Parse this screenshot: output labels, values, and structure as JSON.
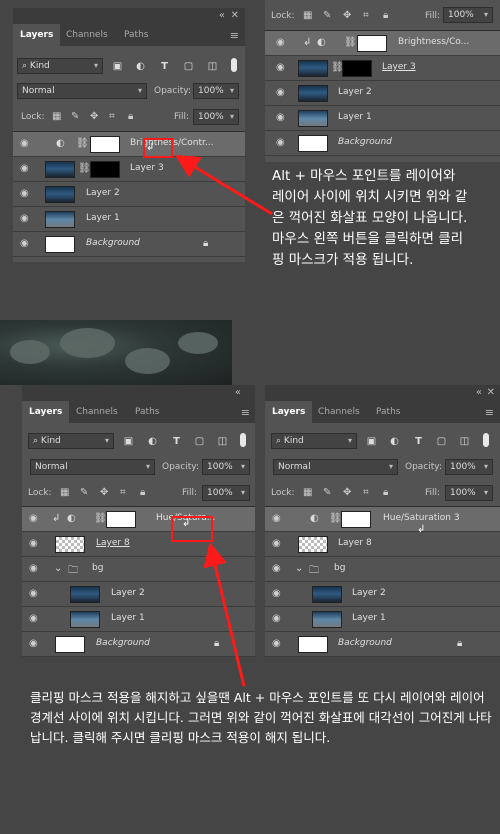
{
  "colors": {
    "accent_red": "#ff1a1a",
    "panel_bg": "#535353",
    "text_white": "#ffffff"
  },
  "panel_a": {
    "tabs": [
      "Layers",
      "Channels",
      "Paths"
    ],
    "filter_kind": "Kind",
    "blend_mode": "Normal",
    "opacity_label": "Opacity:",
    "opacity_value": "100%",
    "lock_label": "Lock:",
    "fill_label": "Fill:",
    "fill_value": "100%",
    "layers": [
      "Brightness/Contr...",
      "Layer 3",
      "Layer 2",
      "Layer 1",
      "Background"
    ]
  },
  "panel_b": {
    "lock_label": "Lock:",
    "fill_label": "Fill:",
    "fill_value": "100%",
    "layers": [
      "Brightness/Co...",
      "Layer 3",
      "Layer 2",
      "Layer 1",
      "Background"
    ]
  },
  "note_top": "Alt + 마우스 포인트를 레이어와 레이어 사이에 위치 시키면 위와 같은 꺽어진 화살표 모양이 나옵니다. 마우스 왼쪽 버튼을 클릭하면 클리핑 마스크가 적용 됩니다.",
  "panel_c": {
    "tabs": [
      "Layers",
      "Channels",
      "Paths"
    ],
    "filter_kind": "Kind",
    "blend_mode": "Normal",
    "opacity_label": "Opacity:",
    "opacity_value": "100%",
    "lock_label": "Lock:",
    "fill_label": "Fill:",
    "fill_value": "100%",
    "layers": [
      "Hue/Satura...",
      "Layer 8",
      "bg",
      "Layer 2",
      "Layer 1",
      "Background"
    ]
  },
  "panel_d": {
    "tabs": [
      "Layers",
      "Channels",
      "Paths"
    ],
    "filter_kind": "Kind",
    "blend_mode": "Normal",
    "opacity_label": "Opacity:",
    "opacity_value": "100%",
    "lock_label": "Lock:",
    "fill_label": "Fill:",
    "fill_value": "100%",
    "layers": [
      "Hue/Saturation 3",
      "Layer 8",
      "bg",
      "Layer 2",
      "Layer 1",
      "Background"
    ]
  },
  "note_bottom": "클리핑 마스크 적용을 해지하고 싶을땐 Alt + 마우스 포인트를 또 다시 레이어와 레이어 경계선 사이에 위치 시킵니다. 그러면 위와 같이 꺽어진 화살표에 대각선이 그어진게 나타납니다. 클릭해 주시면 클리핑 마스크 적용이 해지 됩니다."
}
